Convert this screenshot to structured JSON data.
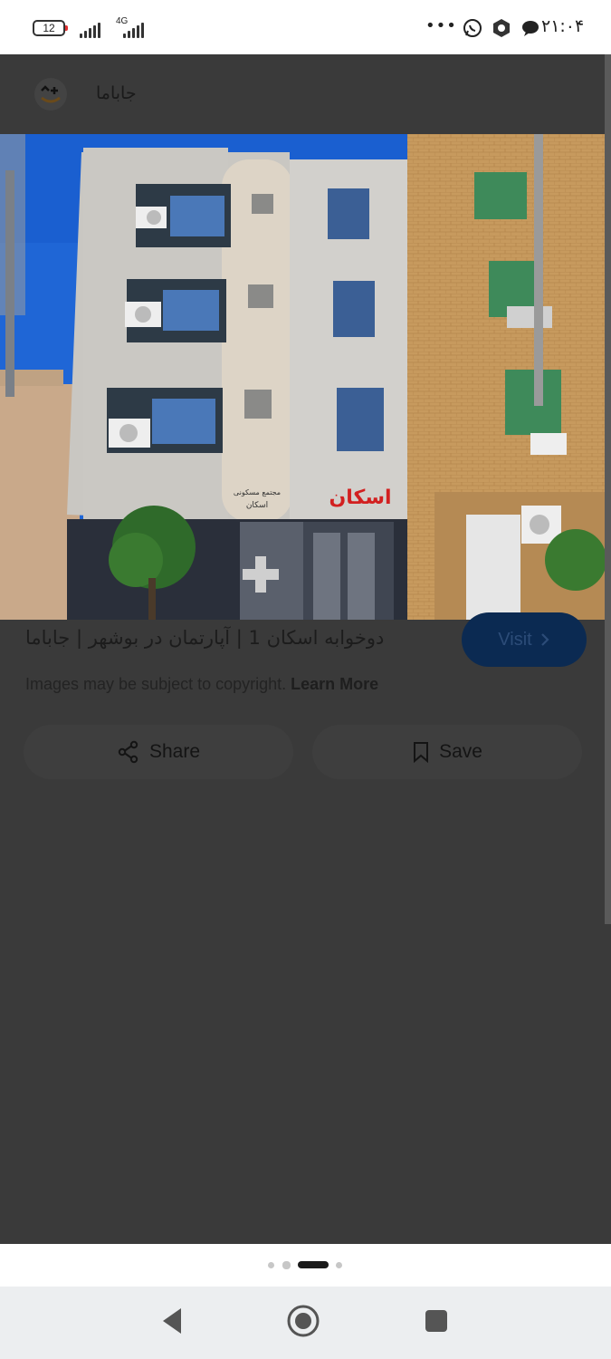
{
  "status_bar": {
    "battery": "12",
    "network": "4G",
    "more": "•••",
    "time": "۲۱:۰۴"
  },
  "header": {
    "site_name": "جاباما"
  },
  "image": {
    "sign_text": "اسکان",
    "small_sign_line1": "مجتمع مسکونی",
    "small_sign_line2": "اسکان"
  },
  "result": {
    "title": "دوخوابه اسکان 1 | آپارتمان در بوشهر | جاباما",
    "visit_label": "Visit",
    "copyright_text": "Images may be subject to copyright.",
    "learn_more": "Learn More",
    "share_label": "Share",
    "save_label": "Save"
  },
  "pager": {
    "current_index": 2,
    "total": 4
  },
  "colors": {
    "overlay": "#3a3a3a",
    "visit_bg": "#0b2a52",
    "sign_red": "#d22020",
    "sky": "#1f66d6"
  },
  "icons": [
    "battery-icon",
    "signal-icon",
    "whatsapp-icon",
    "hexagon-icon",
    "chat-icon",
    "smile-plus-icon",
    "chevron-right-icon",
    "share-icon",
    "bookmark-icon",
    "back-icon",
    "home-icon",
    "recents-icon"
  ]
}
